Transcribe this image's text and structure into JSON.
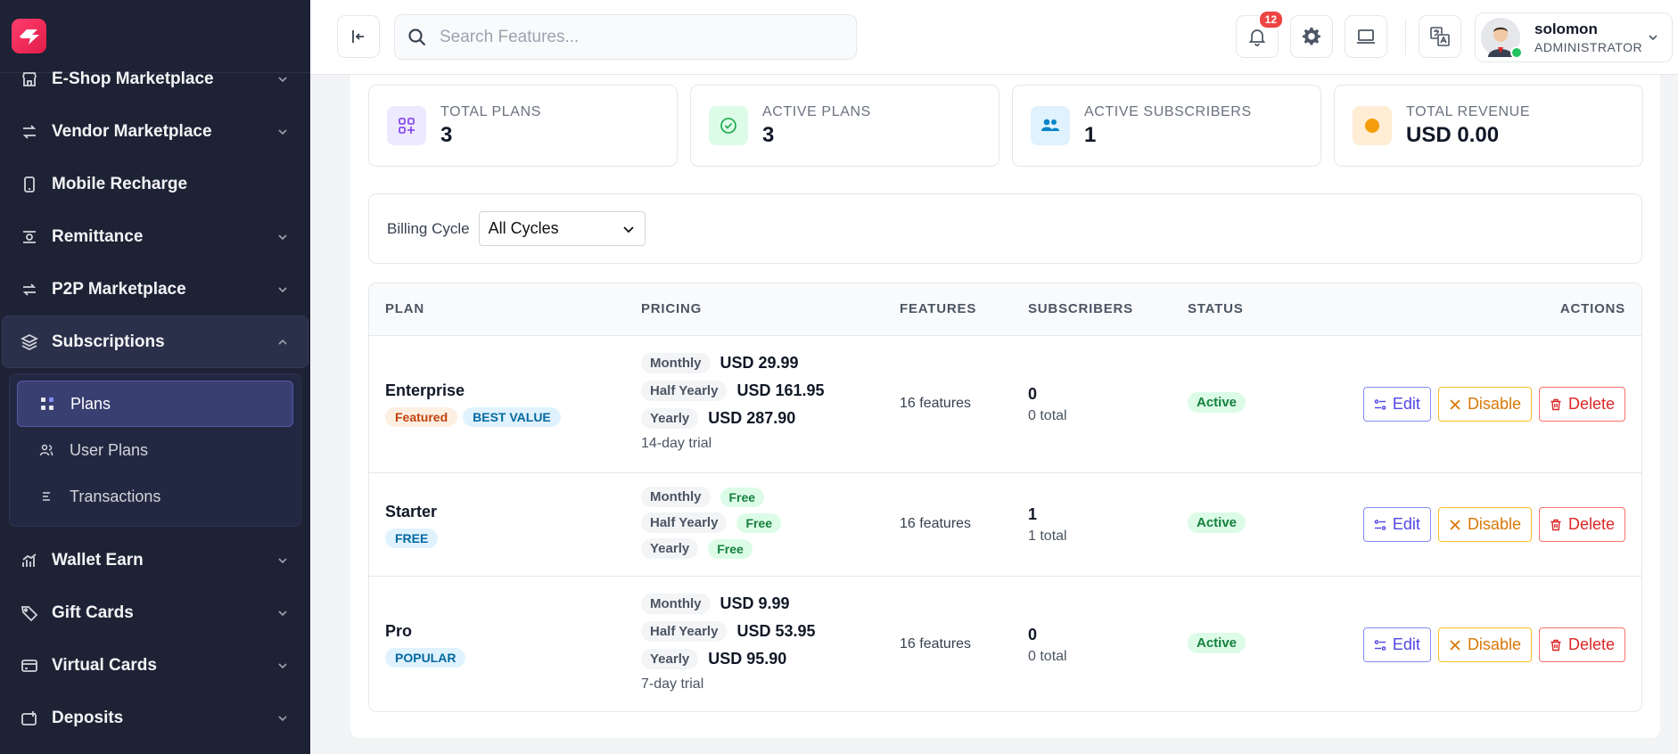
{
  "sidebar": {
    "items_top": [
      {
        "label": "E-Shop Marketplace"
      },
      {
        "label": "Vendor Marketplace"
      },
      {
        "label": "Mobile Recharge"
      },
      {
        "label": "Remittance"
      },
      {
        "label": "P2P Marketplace"
      },
      {
        "label": "Subscriptions"
      }
    ],
    "sub_items": [
      {
        "label": "Plans"
      },
      {
        "label": "User Plans"
      },
      {
        "label": "Transactions"
      }
    ],
    "items_bottom": [
      {
        "label": "Wallet Earn"
      },
      {
        "label": "Gift Cards"
      },
      {
        "label": "Virtual Cards"
      },
      {
        "label": "Deposits"
      }
    ]
  },
  "topbar": {
    "search_placeholder": "Search Features...",
    "notifications_count": "12",
    "user": {
      "name": "solomon",
      "role": "ADMINISTRATOR"
    }
  },
  "stats": [
    {
      "label": "TOTAL PLANS",
      "value": "3"
    },
    {
      "label": "ACTIVE PLANS",
      "value": "3"
    },
    {
      "label": "ACTIVE SUBSCRIBERS",
      "value": "1"
    },
    {
      "label": "TOTAL REVENUE",
      "value": "USD 0.00"
    }
  ],
  "filter": {
    "label": "Billing Cycle",
    "value": "All Cycles"
  },
  "table": {
    "headers": {
      "plan": "PLAN",
      "pricing": "PRICING",
      "features": "FEATURES",
      "subscribers": "SUBSCRIBERS",
      "status": "STATUS",
      "actions": "ACTIONS"
    },
    "actions": {
      "edit": "Edit",
      "disable": "Disable",
      "delete": "Delete"
    },
    "rows": [
      {
        "name": "Enterprise",
        "tags": [
          "Featured",
          "BEST VALUE"
        ],
        "prices": [
          {
            "cycle": "Monthly",
            "amount": "USD 29.99"
          },
          {
            "cycle": "Half Yearly",
            "amount": "USD 161.95"
          },
          {
            "cycle": "Yearly",
            "amount": "USD 287.90"
          }
        ],
        "trial": "14-day trial",
        "features": "16 features",
        "subscribers": "0",
        "subscribers_total": "0 total",
        "status": "Active"
      },
      {
        "name": "Starter",
        "tags": [
          "FREE"
        ],
        "prices": [
          {
            "cycle": "Monthly",
            "amount": "Free"
          },
          {
            "cycle": "Half Yearly",
            "amount": "Free"
          },
          {
            "cycle": "Yearly",
            "amount": "Free"
          }
        ],
        "features": "16 features",
        "subscribers": "1",
        "subscribers_total": "1 total",
        "status": "Active"
      },
      {
        "name": "Pro",
        "tags": [
          "POPULAR"
        ],
        "prices": [
          {
            "cycle": "Monthly",
            "amount": "USD 9.99"
          },
          {
            "cycle": "Half Yearly",
            "amount": "USD 53.95"
          },
          {
            "cycle": "Yearly",
            "amount": "USD 95.90"
          }
        ],
        "trial": "7-day trial",
        "features": "16 features",
        "subscribers": "0",
        "subscribers_total": "0 total",
        "status": "Active"
      }
    ]
  }
}
